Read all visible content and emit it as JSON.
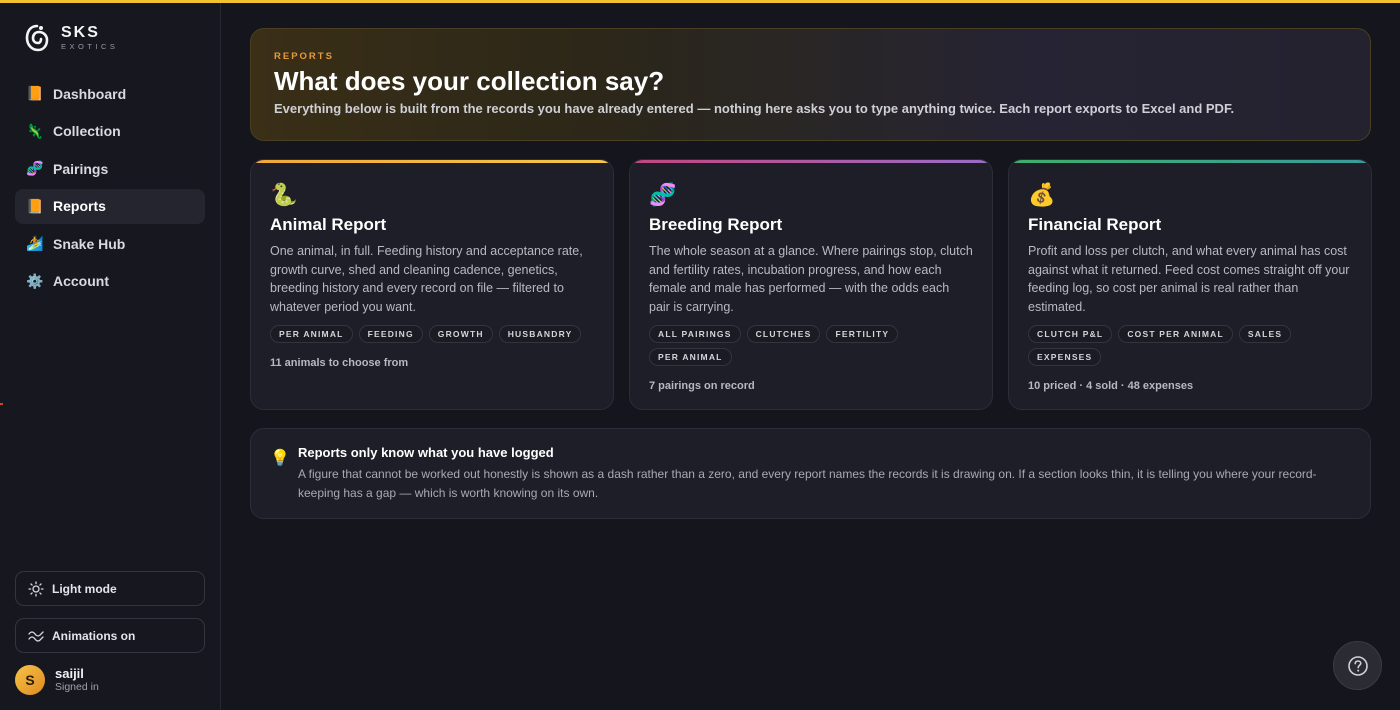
{
  "brand": {
    "name": "SKS",
    "subtitle": "EXOTICS"
  },
  "sidebar": {
    "items": [
      {
        "label": "Dashboard",
        "icon": "📙"
      },
      {
        "label": "Collection",
        "icon": "🦎"
      },
      {
        "label": "Pairings",
        "icon": "🧬"
      },
      {
        "label": "Reports",
        "icon": "📙",
        "active": true
      },
      {
        "label": "Snake Hub",
        "icon": "🏄"
      },
      {
        "label": "Account",
        "icon": "⚙️"
      }
    ],
    "light_mode_label": "Light mode",
    "animations_label": "Animations on"
  },
  "user": {
    "initial": "S",
    "name": "saijil",
    "status": "Signed in"
  },
  "hero": {
    "kicker": "REPORTS",
    "title": "What does your collection say?",
    "subtitle": "Everything below is built from the records you have already entered — nothing here asks you to type anything twice. Each report exports to Excel and PDF."
  },
  "cards": [
    {
      "icon": "🐍",
      "title": "Animal Report",
      "description": "One animal, in full. Feeding history and acceptance rate, growth curve, shed and cleaning cadence, genetics, breeding history and every record on file — filtered to whatever period you want.",
      "tags": [
        "PER ANIMAL",
        "FEEDING",
        "GROWTH",
        "HUSBANDRY"
      ],
      "meta": "11 animals to choose from",
      "accent": "#f0a83a"
    },
    {
      "icon": "🧬",
      "title": "Breeding Report",
      "description": "The whole season at a glance. Where pairings stop, clutch and fertility rates, incubation progress, and how each female and male has performed — with the odds each pair is carrying.",
      "tags": [
        "ALL PAIRINGS",
        "CLUTCHES",
        "FERTILITY",
        "PER ANIMAL"
      ],
      "meta": "7 pairings on record",
      "accent": "#b45aa0"
    },
    {
      "icon": "💰",
      "title": "Financial Report",
      "description": "Profit and loss per clutch, and what every animal has cost against what it returned. Feed cost comes straight off your feeding log, so cost per animal is real rather than estimated.",
      "tags": [
        "CLUTCH P&L",
        "COST PER ANIMAL",
        "SALES",
        "EXPENSES"
      ],
      "meta": "10 priced · 4 sold · 48 expenses",
      "accent": "#3fae6a"
    }
  ],
  "tip": {
    "icon": "💡",
    "title": "Reports only know what you have logged",
    "body": "A figure that cannot be worked out honestly is shown as a dash rather than a zero, and every report names the records it is drawing on. If a section looks thin, it is telling you where your record-keeping has a gap — which is worth knowing on its own."
  },
  "colors": {
    "accent_top": "#f2c230",
    "kicker": "#e79a3c",
    "background": "#15161d"
  }
}
